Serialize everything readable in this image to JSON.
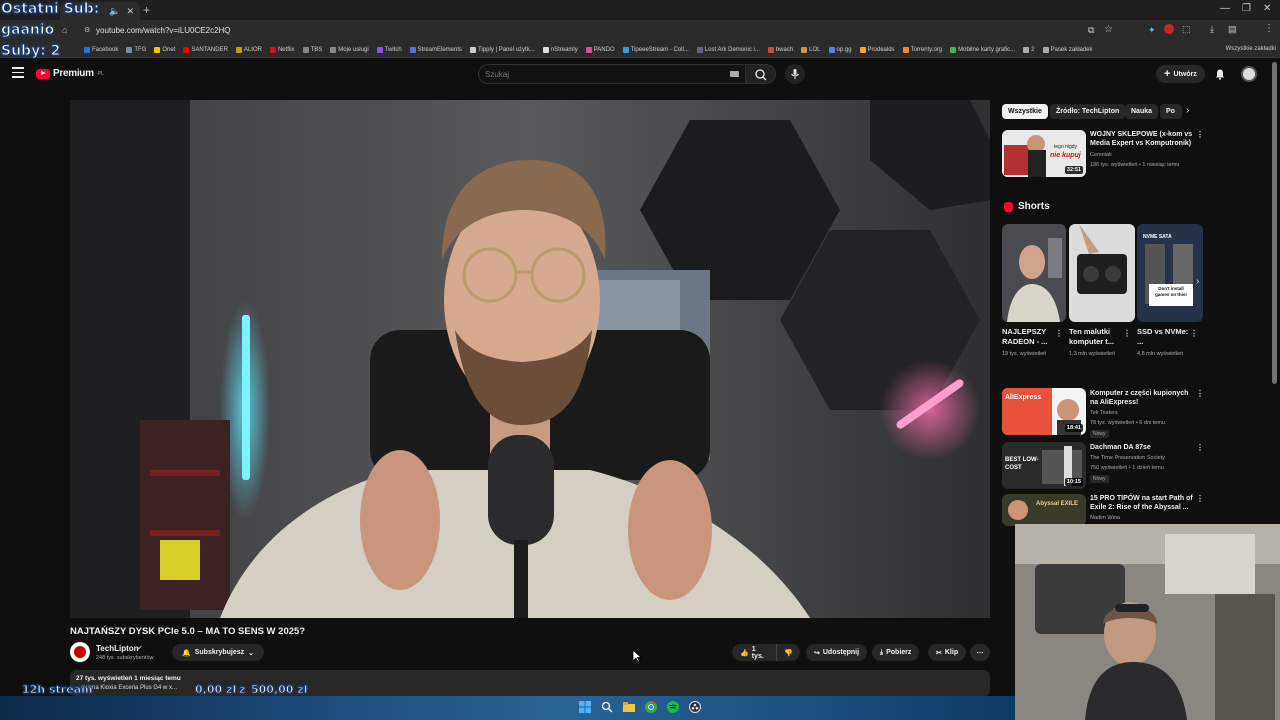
{
  "browser": {
    "tab_title": "",
    "url": "youtube.com/watch?v=iLU0CE2c2HQ",
    "bookmarks": [
      {
        "label": "Facebook",
        "color": "#1877f2"
      },
      {
        "label": "TFG",
        "color": "#7a8ca0"
      },
      {
        "label": "Onet",
        "color": "#f5c400"
      },
      {
        "label": "SANTANDER",
        "color": "#ec0000"
      },
      {
        "label": "ALIOR",
        "color": "#c59a00"
      },
      {
        "label": "Netflix",
        "color": "#e50914"
      },
      {
        "label": "TBS",
        "color": "#888888"
      },
      {
        "label": "Moje usługi",
        "color": "#888888"
      },
      {
        "label": "Twitch",
        "color": "#9146ff"
      },
      {
        "label": "StreamElements",
        "color": "#5b6ee1"
      },
      {
        "label": "Tipply | Panel użytk...",
        "color": "#cccccc"
      },
      {
        "label": "nStreamly",
        "color": "#dddddd"
      },
      {
        "label": "PANDO",
        "color": "#e64a8b"
      },
      {
        "label": "TipeeeStream - Coll...",
        "color": "#2d9cdb"
      },
      {
        "label": "Lost Ark Demonic i...",
        "color": "#6b5b95"
      },
      {
        "label": "bwach",
        "color": "#d2453a"
      },
      {
        "label": "LOL",
        "color": "#c89b3c"
      },
      {
        "label": "op.gg",
        "color": "#5383e8"
      },
      {
        "label": "Prodealds",
        "color": "#f5a623"
      },
      {
        "label": "Torrenty.org",
        "color": "#f08a24"
      },
      {
        "label": "Mobilne karty grafic...",
        "color": "#4caf50"
      },
      {
        "label": "2",
        "color": "#aaaaaa"
      },
      {
        "label": "Pasek zakładek",
        "color": "#aaaaaa"
      }
    ],
    "all_bookmarks": "Wszystkie zakładki"
  },
  "overlay": {
    "last_sub_label": "Ostatni Sub:",
    "last_sub_name": "gaanio",
    "subs_count": "Suby: 2",
    "stream_label": "12h stream",
    "goal_current": "0,00 zł",
    "goal_sep": "z",
    "goal_target": "500,00 zł"
  },
  "youtube": {
    "logo_text": "Premium",
    "logo_country": "PL",
    "search_placeholder": "Szukaj",
    "create_label": "Utwórz",
    "video": {
      "title": "NAJTAŃSZY DYSK PCIe 5.0 – MA TO SENS W 2025?",
      "channel": "TechLipton",
      "subscribers": "248 tys. subskrybentów",
      "subscribed_label": "Subskrybujesz",
      "likes": "1 tys.",
      "share": "Udostępnij",
      "download": "Pobierz",
      "clip": "Klip",
      "views_date": "27 tys. wyświetleń  1 miesiąc temu",
      "description": "...owana Kioxia Exceria Plus G4 w x..."
    },
    "chips": [
      "Wszystkie",
      "Źródło: TechLipton",
      "Nauka",
      "Po"
    ],
    "shorts_heading": "Shorts",
    "related": [
      {
        "title": "WOJNY SKLEPOWE (x-kom vs Media Expert vs Komputronik)",
        "channel": "Cemniak",
        "meta": "186 tys. wyświetleń • 1 miesiąc temu",
        "duration": "32:51",
        "badge": "",
        "thumb_text": "tego nigdy nie kupuj"
      },
      {
        "title": "Komputer z części kupionych na AliExpress!",
        "channel": "Tek Testers",
        "meta": "78 tys. wyświetleń • 6 dni temu",
        "duration": "18:41",
        "badge": "Nowy",
        "thumb_text": "AliExpress"
      },
      {
        "title": "Dachman DA 87se",
        "channel": "The Time Preservation Society",
        "meta": "750 wyświetleń • 1 dzień temu",
        "duration": "10:15",
        "badge": "Nowy",
        "thumb_text": "BEST LOW-COST"
      },
      {
        "title": "15 PRO TIPÓW na start Path of Exile 2: Rise of the Abyssal ...",
        "channel": "Nadim Wina",
        "meta": "",
        "duration": "",
        "badge": "",
        "thumb_text": "Abyssal EXILE"
      }
    ],
    "shorts": [
      {
        "title": "NAJLEPSZY RADEON - ...",
        "meta": "19 tys. wyświetleń"
      },
      {
        "title": "Ten malutki komputer t...",
        "meta": "1,3 mln wyświetleń"
      },
      {
        "title": "SSD vs NVMe: ...",
        "meta": "4,8 mln wyświetleń",
        "thumb_text": "Don't install games on this!",
        "labels": "NVME SATA"
      }
    ]
  },
  "colors": {
    "yt_red": "#ff0033",
    "bg": "#0f0f0f",
    "chip": "#272727"
  }
}
